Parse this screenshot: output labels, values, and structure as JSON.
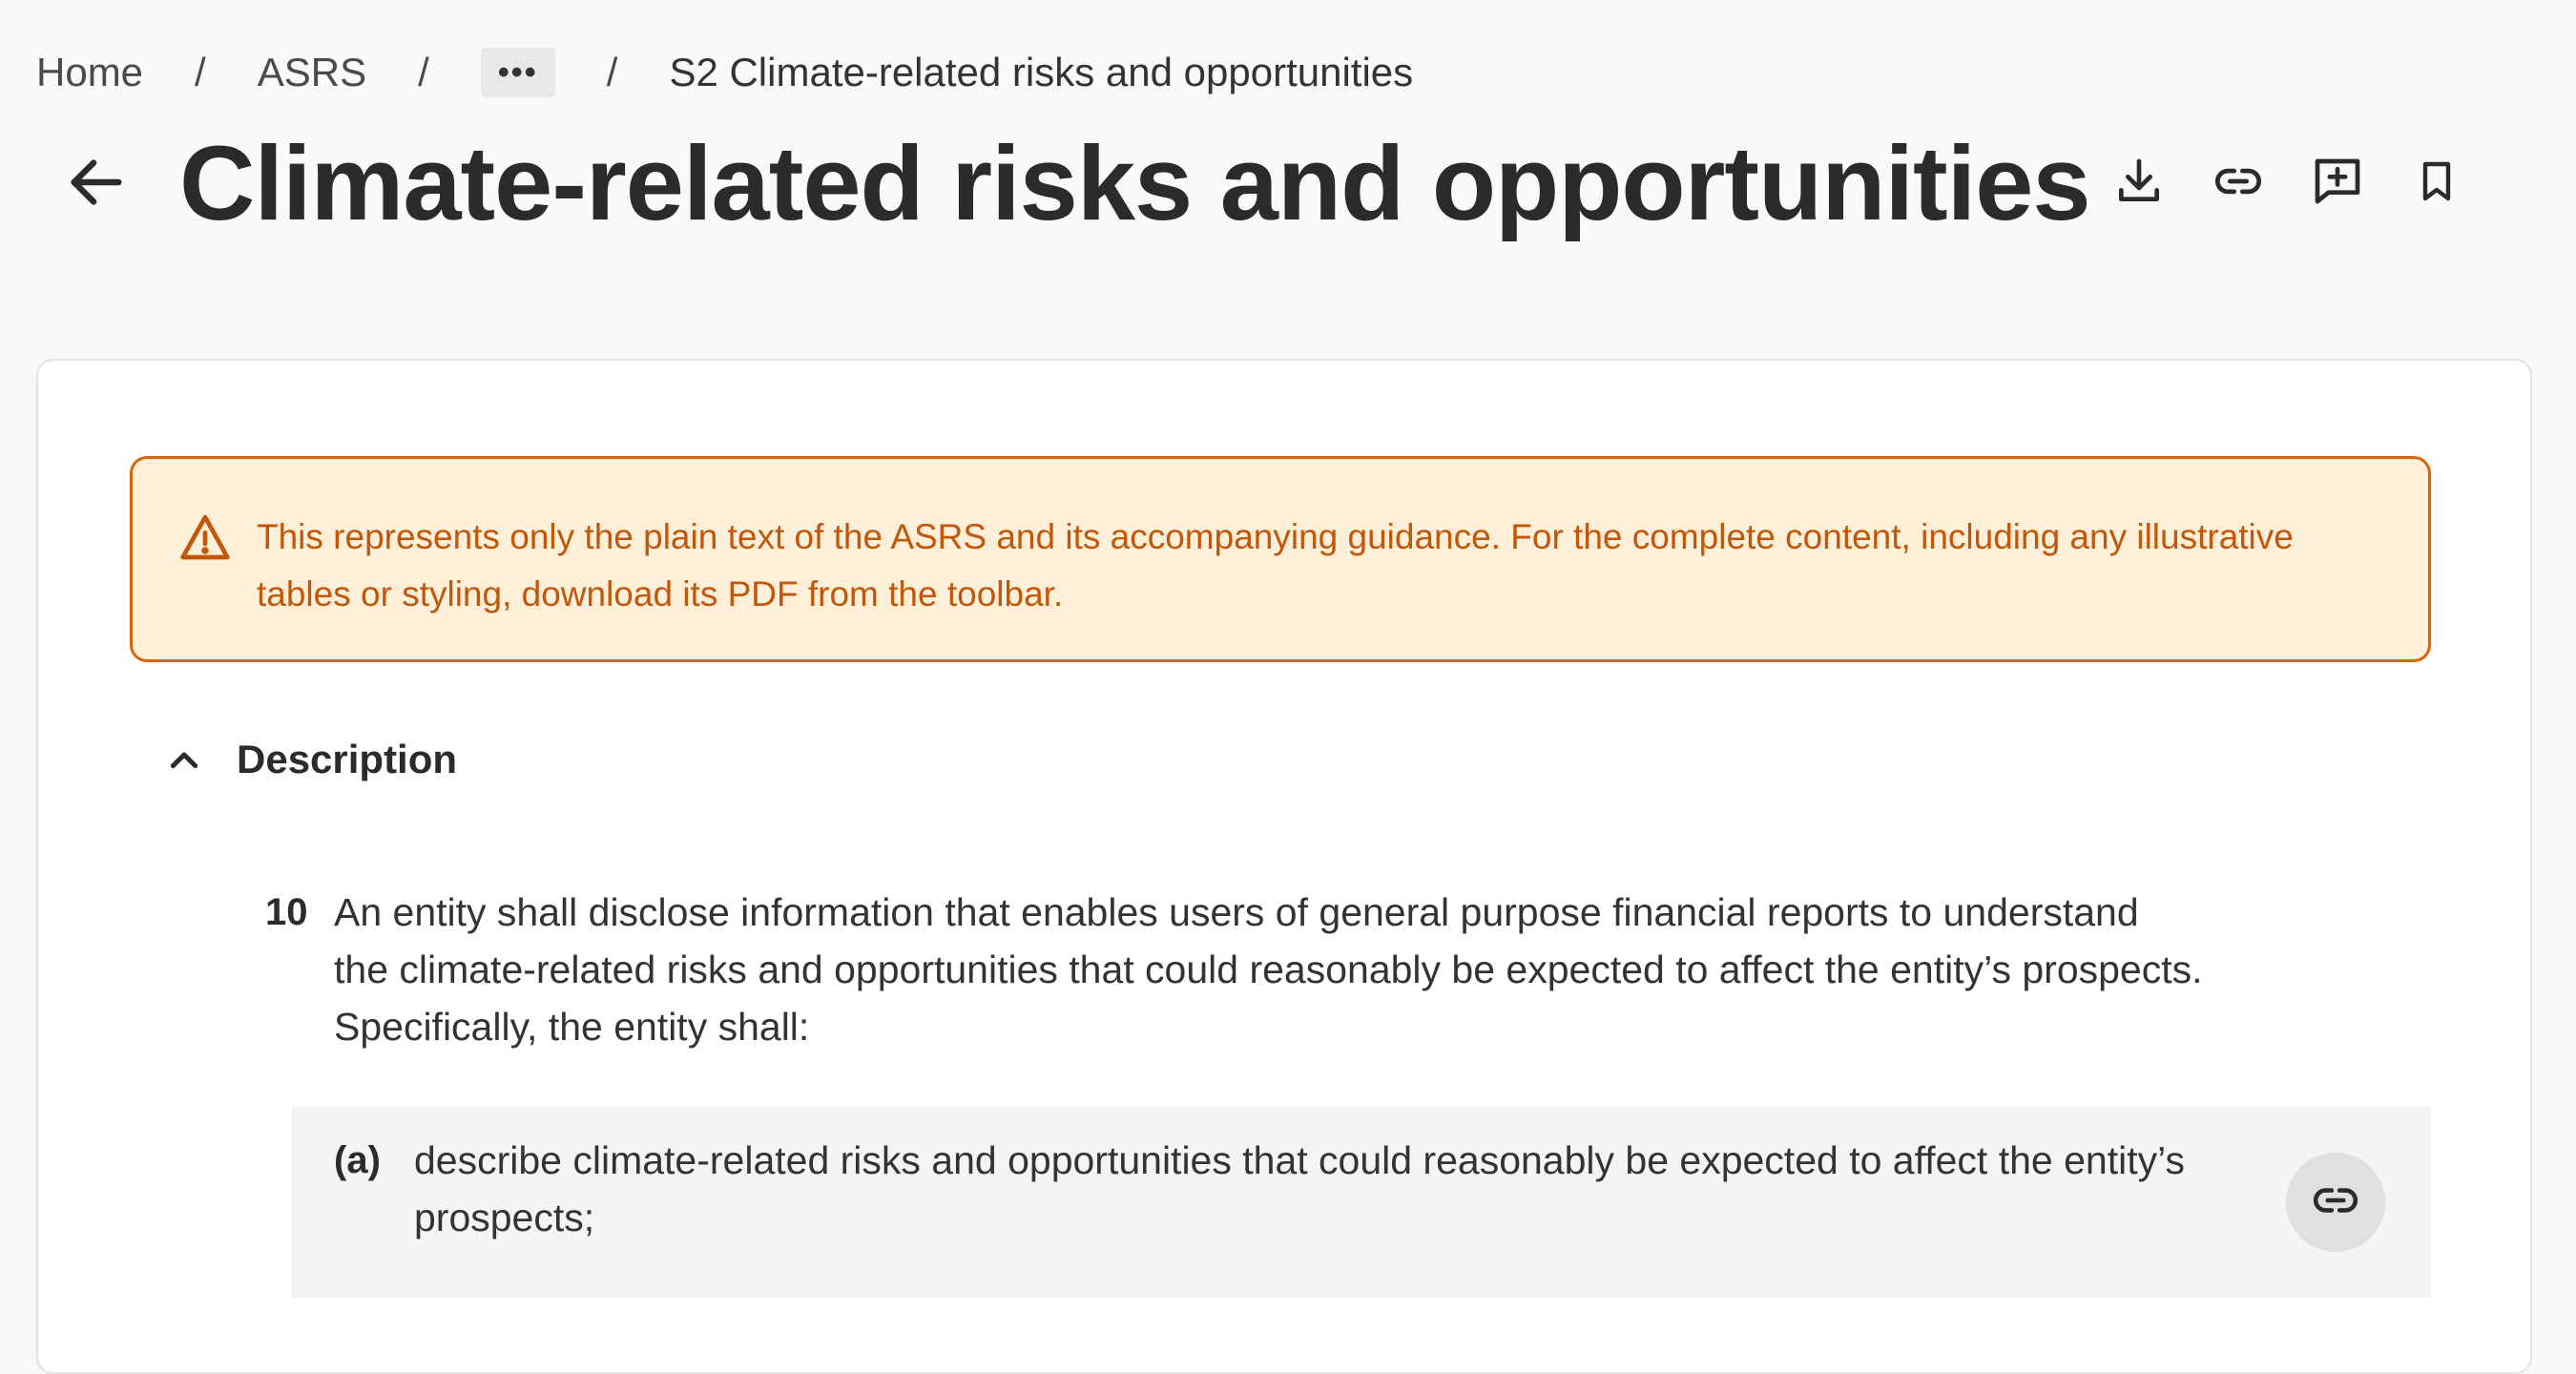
{
  "breadcrumb": {
    "items": [
      "Home",
      "ASRS"
    ],
    "separator": "/",
    "ellipsis": "•••",
    "current": "S2 Climate-related risks and opportunities"
  },
  "header": {
    "title": "Climate-related risks and opportunities",
    "back_icon": "arrow-left-icon",
    "toolbar_icons": [
      "download-icon",
      "link-icon",
      "add-comment-icon",
      "bookmark-icon"
    ]
  },
  "warning": {
    "icon": "warning-triangle-icon",
    "text": "This represents only the plain text of the ASRS and its accompanying guidance. For the complete content, including any illustrative tables or styling, download its PDF from the toolbar.",
    "color": "#c2570a",
    "background": "#feefd9",
    "border": "#d9650c"
  },
  "section": {
    "title": "Description",
    "expanded": true,
    "icon": "chevron-up-icon"
  },
  "paragraph": {
    "number": "10",
    "text": "An entity shall disclose information that enables users of general purpose financial reports to understand the climate-related risks and opportunities that could reasonably be expected to affect the entity’s prospects. Specifically, the entity shall:"
  },
  "subitems": [
    {
      "label": "(a)",
      "text": "describe climate-related risks and opportunities that could reasonably be expected to affect the entity’s prospects;",
      "action_icon": "link-icon"
    }
  ]
}
